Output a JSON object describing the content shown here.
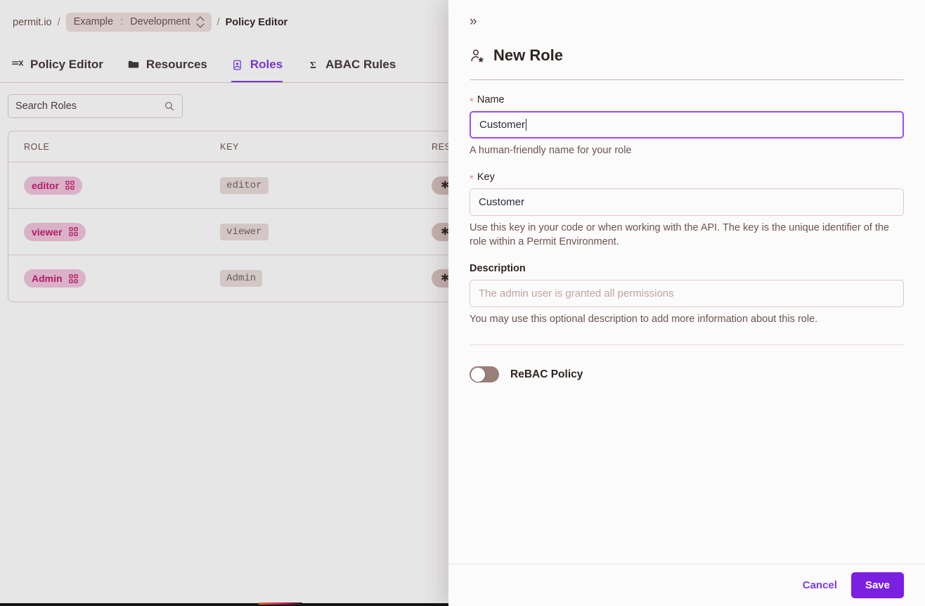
{
  "breadcrumb": {
    "root": "permit.io",
    "separator": "/",
    "environment_chip": {
      "project": "Example",
      "colon": ":",
      "environment": "Development",
      "icon": "chevron-up-down-icon"
    },
    "current": "Policy Editor"
  },
  "tabs": [
    {
      "label": "Policy Editor",
      "icon": "policy-editor-icon",
      "active": false
    },
    {
      "label": "Resources",
      "icon": "folder-icon",
      "active": false
    },
    {
      "label": "Roles",
      "icon": "roles-badge-icon",
      "active": true
    },
    {
      "label": "ABAC Rules",
      "icon": "sigma-icon",
      "active": false
    }
  ],
  "search": {
    "value": "Search Roles",
    "placeholder": "Search Roles",
    "icon": "search-icon"
  },
  "table": {
    "columns": [
      "ROLE",
      "KEY",
      "RESOURCES"
    ],
    "rows": [
      {
        "role": "editor",
        "key": "editor",
        "resources": "* A",
        "role_icon": "grid-icon"
      },
      {
        "role": "viewer",
        "key": "viewer",
        "resources": "* A",
        "role_icon": "grid-icon"
      },
      {
        "role": "Admin",
        "key": "Admin",
        "resources": "* A",
        "role_icon": "grid-icon"
      }
    ]
  },
  "drawer": {
    "collapse_icon": "chevron-double-right-icon",
    "collapse_glyph": "»",
    "title": "New Role",
    "title_icon": "user-add-icon",
    "fields": {
      "name": {
        "label": "Name",
        "required_marker": "*",
        "value": "Customer",
        "placeholder": "",
        "helper": "A human-friendly name for your role",
        "focused": true
      },
      "key": {
        "label": "Key",
        "required_marker": "*",
        "value": "Customer",
        "placeholder": "",
        "helper": "Use this key in your code or when working with the API. The key is the unique identifier of the role within a Permit Environment.",
        "focused": false
      },
      "description": {
        "label": "Description",
        "required_marker": "",
        "value": "",
        "placeholder": "The admin user is granted all permissions",
        "helper": "You may use this optional description to add more information about this role.",
        "focused": false
      }
    },
    "rebac": {
      "label": "ReBAC Policy",
      "enabled": false
    },
    "footer": {
      "cancel_label": "Cancel",
      "save_label": "Save"
    }
  },
  "colors": {
    "accent_purple": "#7c3aed",
    "save_purple": "#7b1fe0",
    "focus_purple": "#9b4dfb",
    "role_chip_bg": "#f0c4dd",
    "role_chip_text": "#c2186e",
    "resource_chip_bg": "#d9c3bf",
    "border_warm": "#dfcac6",
    "text_dark": "#2f2422",
    "helper_text": "#6b5350"
  }
}
